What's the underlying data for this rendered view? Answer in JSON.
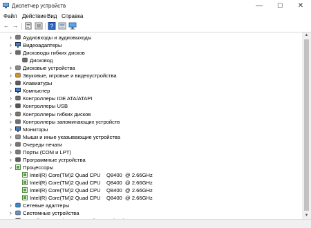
{
  "window": {
    "title": "Диспетчер устройств",
    "minimize": "—",
    "maximize": "☐",
    "close": "✕"
  },
  "menu": [
    "Файл",
    "Действие",
    "Вид",
    "Справка"
  ],
  "toolbar": {
    "back": "←",
    "forward": "→"
  },
  "tree": [
    {
      "label": "Аудиовходы и аудиовыходы",
      "level": 0,
      "expander": "›",
      "icon": "audio-io-icon"
    },
    {
      "label": "Видеоадаптеры",
      "level": 0,
      "expander": "›",
      "icon": "display-adapter-icon"
    },
    {
      "label": "Дисководы гибких дисков",
      "level": 0,
      "expander": "⌄",
      "icon": "floppy-drive-icon"
    },
    {
      "label": "Дисковод",
      "level": 1,
      "expander": "",
      "icon": "floppy-drive-icon"
    },
    {
      "label": "Дисковые устройства",
      "level": 0,
      "expander": "›",
      "icon": "disk-drive-icon"
    },
    {
      "label": "Звуковые, игровые и видеоустройства",
      "level": 0,
      "expander": "›",
      "icon": "sound-icon"
    },
    {
      "label": "Клавиатуры",
      "level": 0,
      "expander": "›",
      "icon": "keyboard-icon"
    },
    {
      "label": "Компьютер",
      "level": 0,
      "expander": "›",
      "icon": "computer-icon"
    },
    {
      "label": "Контроллеры IDE ATA/ATAPI",
      "level": 0,
      "expander": "›",
      "icon": "ide-controller-icon"
    },
    {
      "label": "Контроллеры USB",
      "level": 0,
      "expander": "›",
      "icon": "usb-icon"
    },
    {
      "label": "Контроллеры гибких дисков",
      "level": 0,
      "expander": "›",
      "icon": "floppy-controller-icon"
    },
    {
      "label": "Контроллеры запоминающих устройств",
      "level": 0,
      "expander": "›",
      "icon": "storage-controller-icon"
    },
    {
      "label": "Мониторы",
      "level": 0,
      "expander": "›",
      "icon": "monitor-icon"
    },
    {
      "label": "Мыши и иные указывающие устройства",
      "level": 0,
      "expander": "›",
      "icon": "mouse-icon"
    },
    {
      "label": "Очереди печати",
      "level": 0,
      "expander": "›",
      "icon": "print-queue-icon"
    },
    {
      "label": "Порты (COM и LPT)",
      "level": 0,
      "expander": "›",
      "icon": "port-icon"
    },
    {
      "label": "Программные устройства",
      "level": 0,
      "expander": "›",
      "icon": "software-device-icon"
    },
    {
      "label": "Процессоры",
      "level": 0,
      "expander": "⌄",
      "icon": "processor-icon"
    },
    {
      "label": "Intel(R) Core(TM)2 Quad CPU    Q8400  @ 2.66GHz",
      "level": 1,
      "expander": "",
      "icon": "processor-icon"
    },
    {
      "label": "Intel(R) Core(TM)2 Quad CPU    Q8400  @ 2.66GHz",
      "level": 1,
      "expander": "",
      "icon": "processor-icon"
    },
    {
      "label": "Intel(R) Core(TM)2 Quad CPU    Q8400  @ 2.66GHz",
      "level": 1,
      "expander": "",
      "icon": "processor-icon"
    },
    {
      "label": "Intel(R) Core(TM)2 Quad CPU    Q8400  @ 2.66GHz",
      "level": 1,
      "expander": "",
      "icon": "processor-icon"
    },
    {
      "label": "Сетевые адаптеры",
      "level": 0,
      "expander": "›",
      "icon": "network-adapter-icon"
    },
    {
      "label": "Системные устройства",
      "level": 0,
      "expander": "›",
      "icon": "system-device-icon"
    },
    {
      "label": "Устройства HID (Human Interface Devices)",
      "level": 0,
      "expander": "›",
      "icon": "hid-icon"
    }
  ],
  "scroll": {
    "up": "▲",
    "down": "▼"
  }
}
